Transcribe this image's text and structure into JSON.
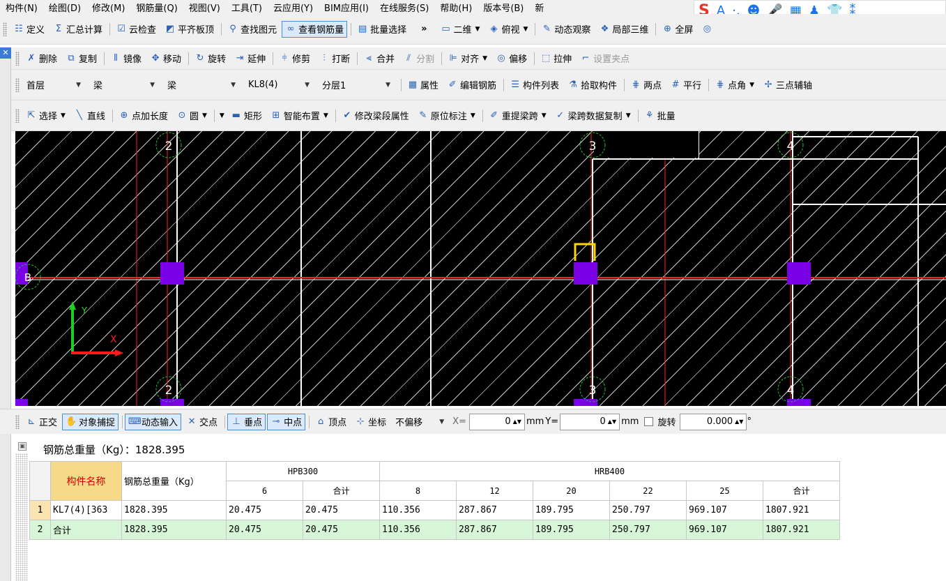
{
  "menubar": {
    "items": [
      "构件(N)",
      "绘图(D)",
      "修改(M)",
      "钢筋量(Q)",
      "视图(V)",
      "工具(T)",
      "云应用(Y)",
      "BIM应用(I)",
      "在线服务(S)",
      "帮助(H)",
      "版本号(B)",
      "新"
    ]
  },
  "ime_toolbar": {
    "items": [
      "S",
      "A",
      "·,",
      "☻",
      "🎤",
      "▦",
      "♟",
      "👕",
      "⁑"
    ]
  },
  "toolbar1": {
    "items": [
      {
        "icon": "define-icon",
        "glyph": "☷",
        "label": "定义"
      },
      {
        "icon": "sigma-icon",
        "glyph": "Σ",
        "label": "汇总计算"
      },
      {
        "icon": "cloud-check-icon",
        "glyph": "☑",
        "label": "云检查"
      },
      {
        "icon": "flat-slab-icon",
        "glyph": "◩",
        "label": "平齐板顶"
      },
      {
        "icon": "binoculars-icon",
        "glyph": "⚲",
        "label": "查找图元"
      },
      {
        "icon": "view-rebar-icon",
        "glyph": "∞",
        "label": "查看钢筋量",
        "active": true
      },
      {
        "icon": "batch-select-icon",
        "glyph": "▤",
        "label": "批量选择"
      }
    ],
    "overflow": "»",
    "right": [
      {
        "icon": "2d-icon",
        "glyph": "▭",
        "label": "二维",
        "dropdown": true
      },
      {
        "icon": "top-view-icon",
        "glyph": "◈",
        "label": "俯视",
        "dropdown": true
      },
      {
        "icon": "dynamic-view-icon",
        "glyph": "✎",
        "label": "动态观察"
      },
      {
        "icon": "local-3d-icon",
        "glyph": "❖",
        "label": "局部三维"
      },
      {
        "icon": "fullscreen-icon",
        "glyph": "⊕",
        "label": "全屏"
      },
      {
        "icon": "zoom-icon",
        "glyph": "◎",
        "label": ""
      }
    ]
  },
  "toolbar2": {
    "items": [
      {
        "icon": "delete-icon",
        "glyph": "✗",
        "label": "删除"
      },
      {
        "icon": "copy-icon",
        "glyph": "⧉",
        "label": "复制"
      },
      {
        "icon": "mirror-icon",
        "glyph": "⫴",
        "label": "镜像"
      },
      {
        "icon": "move-icon",
        "glyph": "✥",
        "label": "移动"
      },
      {
        "icon": "rotate-icon",
        "glyph": "↻",
        "label": "旋转"
      },
      {
        "icon": "extend-icon",
        "glyph": "⇥",
        "label": "延伸"
      },
      {
        "icon": "trim-icon",
        "glyph": "⫩",
        "label": "修剪"
      },
      {
        "icon": "break-icon",
        "glyph": "⫶",
        "label": "打断"
      },
      {
        "icon": "merge-icon",
        "glyph": "⫷",
        "label": "合并"
      },
      {
        "icon": "split-icon",
        "glyph": "⫽",
        "label": "分割",
        "disabled": true
      },
      {
        "icon": "align-icon",
        "glyph": "⊫",
        "label": "对齐",
        "dropdown": true
      },
      {
        "icon": "offset-icon",
        "glyph": "◎",
        "label": "偏移"
      },
      {
        "icon": "stretch-icon",
        "glyph": "⬚",
        "label": "拉伸"
      },
      {
        "icon": "grip-point-icon",
        "glyph": "⌐",
        "label": "设置夹点",
        "disabled": true
      }
    ]
  },
  "toolbar3": {
    "combos": [
      {
        "name": "floor-select",
        "value": "首层"
      },
      {
        "name": "category-select",
        "value": "梁"
      },
      {
        "name": "type-select",
        "value": "梁"
      },
      {
        "name": "component-select",
        "value": "KL8(4)"
      },
      {
        "name": "layer-select",
        "value": "分层1"
      }
    ],
    "items": [
      {
        "icon": "properties-icon",
        "glyph": "▦",
        "label": "属性"
      },
      {
        "icon": "edit-rebar-icon",
        "glyph": "✐",
        "label": "编辑钢筋"
      },
      {
        "icon": "component-list-icon",
        "glyph": "☰",
        "label": "构件列表"
      },
      {
        "icon": "pick-icon",
        "glyph": "⚗",
        "label": "拾取构件"
      },
      {
        "icon": "two-point-icon",
        "glyph": "⋕",
        "label": "两点"
      },
      {
        "icon": "parallel-icon",
        "glyph": "#",
        "label": "平行"
      },
      {
        "icon": "point-angle-icon",
        "glyph": "⋕",
        "label": "点角",
        "dropdown": true
      },
      {
        "icon": "three-point-icon",
        "glyph": "✢",
        "label": "三点辅轴"
      }
    ]
  },
  "toolbar4": {
    "items": [
      {
        "icon": "cursor-icon",
        "glyph": "⇱",
        "label": "选择",
        "dropdown": true
      },
      {
        "icon": "line-icon",
        "glyph": "╲",
        "label": "直线"
      },
      {
        "icon": "point-length-icon",
        "glyph": "⊕",
        "label": "点加长度"
      },
      {
        "icon": "circle-icon",
        "glyph": "⊙",
        "label": "圆",
        "dropdown": true
      },
      {
        "icon": "rect-icon",
        "glyph": "▬",
        "label": "矩形",
        "dropdown_before": true
      },
      {
        "icon": "smart-layout-icon",
        "glyph": "⊞",
        "label": "智能布置",
        "dropdown": true
      },
      {
        "icon": "modify-span-icon",
        "glyph": "✔",
        "label": "修改梁段属性"
      },
      {
        "icon": "in-situ-mark-icon",
        "glyph": "✎",
        "label": "原位标注",
        "dropdown": true
      },
      {
        "icon": "re-extract-span-icon",
        "glyph": "✐",
        "label": "重提梁跨",
        "dropdown": true
      },
      {
        "icon": "span-copy-icon",
        "glyph": "✓",
        "label": "梁跨数据复制",
        "dropdown": true
      },
      {
        "icon": "batch-icon",
        "glyph": "⚘",
        "label": "批量"
      }
    ]
  },
  "canvas": {
    "axis_labels_top": [
      "2",
      "3",
      "4"
    ],
    "axis_labels_bottom": [
      "2",
      "3",
      "4"
    ],
    "axis_label_left": "B",
    "ucs": {
      "x": "X",
      "y": "Y"
    },
    "colors": {
      "background": "#000000",
      "grid_line": "#ff2020",
      "beam_line": "#ffffff",
      "column": "#7a00e6",
      "axis_circle": "#1fbf3a",
      "selection": "#ffd500"
    }
  },
  "snapbar": {
    "items": [
      {
        "icon": "ortho-icon",
        "glyph": "⊾",
        "label": "正交",
        "active": false
      },
      {
        "icon": "object-snap-icon",
        "glyph": "✋",
        "label": "对象捕捉",
        "active": true
      },
      {
        "icon": "dynamic-input-icon",
        "glyph": "⌨",
        "label": "动态输入",
        "active": true
      },
      {
        "icon": "intersection-icon",
        "glyph": "✕",
        "label": "交点",
        "active": false
      },
      {
        "icon": "perpendicular-icon",
        "glyph": "⊥",
        "label": "垂点",
        "active": true
      },
      {
        "icon": "midpoint-icon",
        "glyph": "⊸",
        "label": "中点",
        "active": true
      },
      {
        "icon": "vertex-icon",
        "glyph": "⌂",
        "label": "顶点",
        "active": false
      },
      {
        "icon": "coordinate-icon",
        "glyph": "⊹",
        "label": "坐标",
        "active": false
      }
    ],
    "offset_select": "不偏移",
    "x_label": "X=",
    "x_value": "0",
    "x_unit": "mm",
    "y_label": "Y=",
    "y_value": "0",
    "y_unit": "mm",
    "rotate_label": "旋转",
    "rotate_value": "0.000",
    "degree": "°"
  },
  "summary": {
    "label": "钢筋总重量（Kg）：1828.395"
  },
  "table": {
    "header_name": "构件名称",
    "header_total": "钢筋总重量（Kg）",
    "group1": "HPB300",
    "group2": "HRB400",
    "sub1": [
      "6",
      "合计"
    ],
    "sub2": [
      "8",
      "12",
      "20",
      "22",
      "25",
      "合计"
    ],
    "rows": [
      {
        "rn": "1",
        "name": "KL7(4)[363",
        "total": "1828.395",
        "c": [
          "20.475",
          "20.475",
          "110.356",
          "287.867",
          "189.795",
          "250.797",
          "969.107",
          "1807.921"
        ]
      },
      {
        "rn": "2",
        "name": "合计",
        "total": "1828.395",
        "c": [
          "20.475",
          "20.475",
          "110.356",
          "287.867",
          "189.795",
          "250.797",
          "969.107",
          "1807.921"
        ]
      }
    ]
  }
}
